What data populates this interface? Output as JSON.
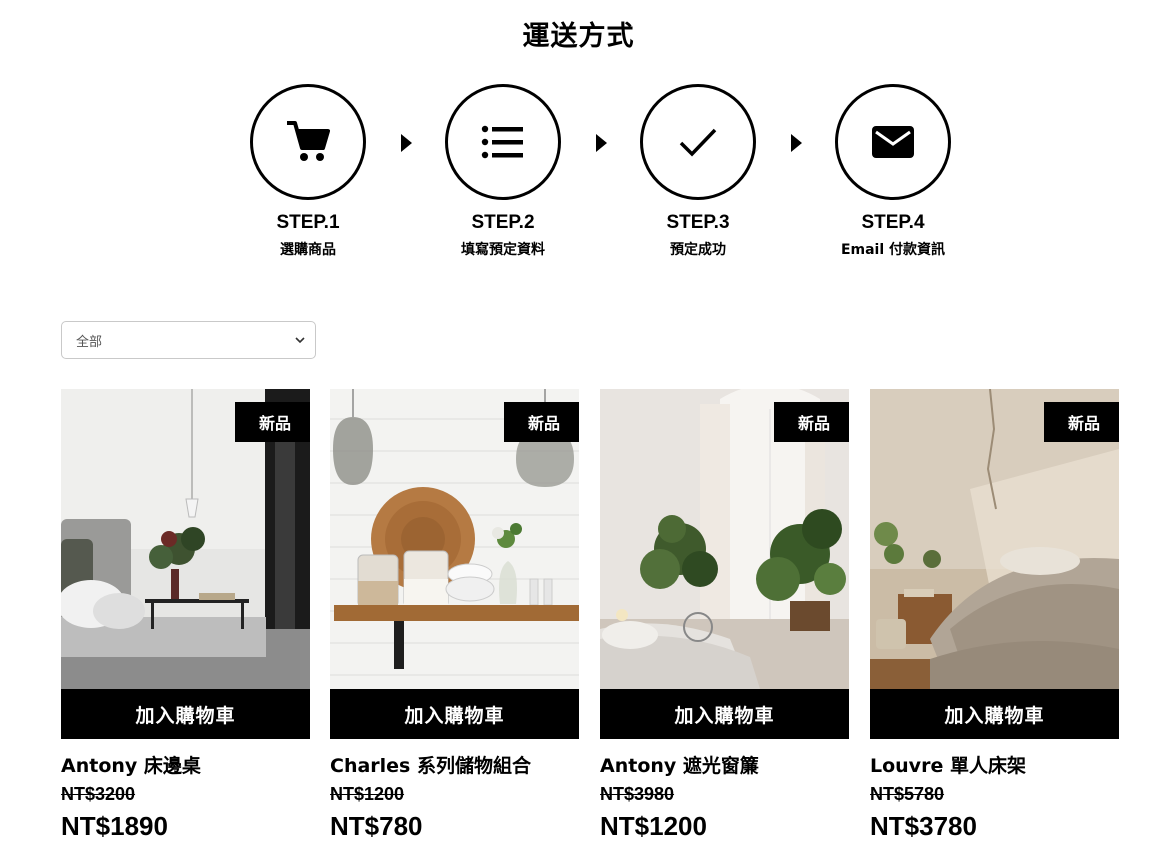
{
  "page": {
    "title": "運送方式"
  },
  "steps": [
    {
      "number": "STEP.1",
      "label": "選購商品",
      "icon": "shopping-cart-icon"
    },
    {
      "number": "STEP.2",
      "label": "填寫預定資料",
      "icon": "list-icon"
    },
    {
      "number": "STEP.3",
      "label": "預定成功",
      "icon": "checkmark-icon"
    },
    {
      "number": "STEP.4",
      "label": "Email 付款資訊",
      "icon": "envelope-icon"
    }
  ],
  "filter": {
    "selected": "全部"
  },
  "products": [
    {
      "badge": "新品",
      "button": "加入購物車",
      "name": "Antony 床邊桌",
      "old_price": "NT$3200",
      "price": "NT$1890"
    },
    {
      "badge": "新品",
      "button": "加入購物車",
      "name": "Charles 系列儲物組合",
      "old_price": "NT$1200",
      "price": "NT$780"
    },
    {
      "badge": "新品",
      "button": "加入購物車",
      "name": "Antony 遮光窗簾",
      "old_price": "NT$3980",
      "price": "NT$1200"
    },
    {
      "badge": "新品",
      "button": "加入購物車",
      "name": "Louvre 單人床架",
      "old_price": "NT$5780",
      "price": "NT$3780"
    }
  ]
}
